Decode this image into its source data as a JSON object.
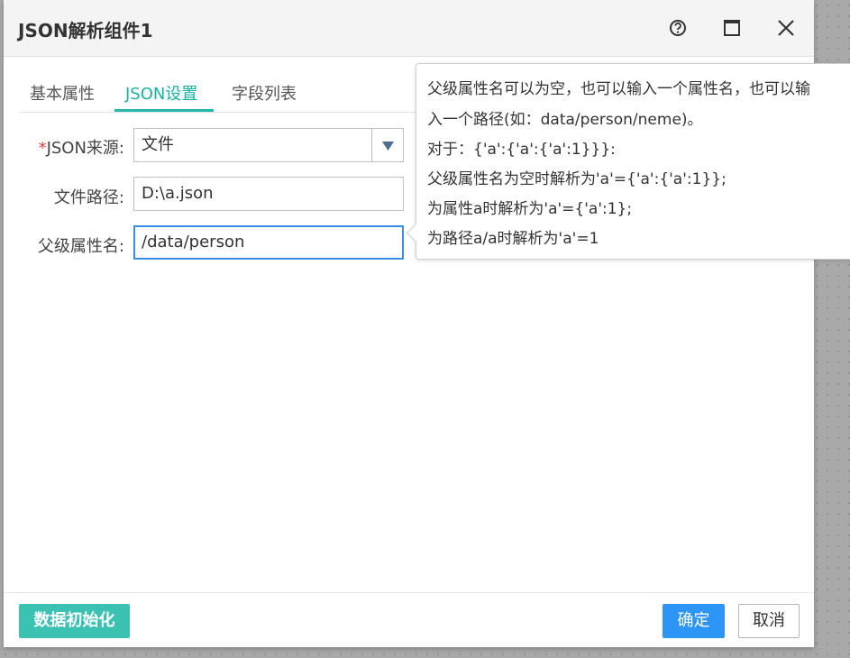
{
  "dialog": {
    "title": "JSON解析组件1",
    "help_icon": "help-circle-icon",
    "maximize_icon": "maximize-icon",
    "close_icon": "close-icon"
  },
  "tabs": [
    {
      "label": "基本属性",
      "active": false
    },
    {
      "label": "JSON设置",
      "active": true
    },
    {
      "label": "字段列表",
      "active": false
    }
  ],
  "form": {
    "source": {
      "required_mark": "*",
      "label": "JSON来源:",
      "value": "文件"
    },
    "path": {
      "label": "文件路径:",
      "value": "D:\\a.json"
    },
    "parent_attr": {
      "label": "父级属性名:",
      "value": "/data/person"
    }
  },
  "tooltip": {
    "lines": [
      "父级属性名可以为空，也可以输入一个属性名，也可以输",
      "入一个路径(如：data/person/neme)。",
      "对于：{'a':{'a':{'a':1}}}:",
      "父级属性名为空时解析为'a'={'a':{'a':1}};",
      "为属性a时解析为'a'={'a':1};",
      "为路径a/a时解析为'a'=1"
    ]
  },
  "footer": {
    "init_label": "数据初始化",
    "ok_label": "确定",
    "cancel_label": "取消"
  },
  "colors": {
    "accent": "#26b7a8",
    "primary": "#2d95f5"
  }
}
